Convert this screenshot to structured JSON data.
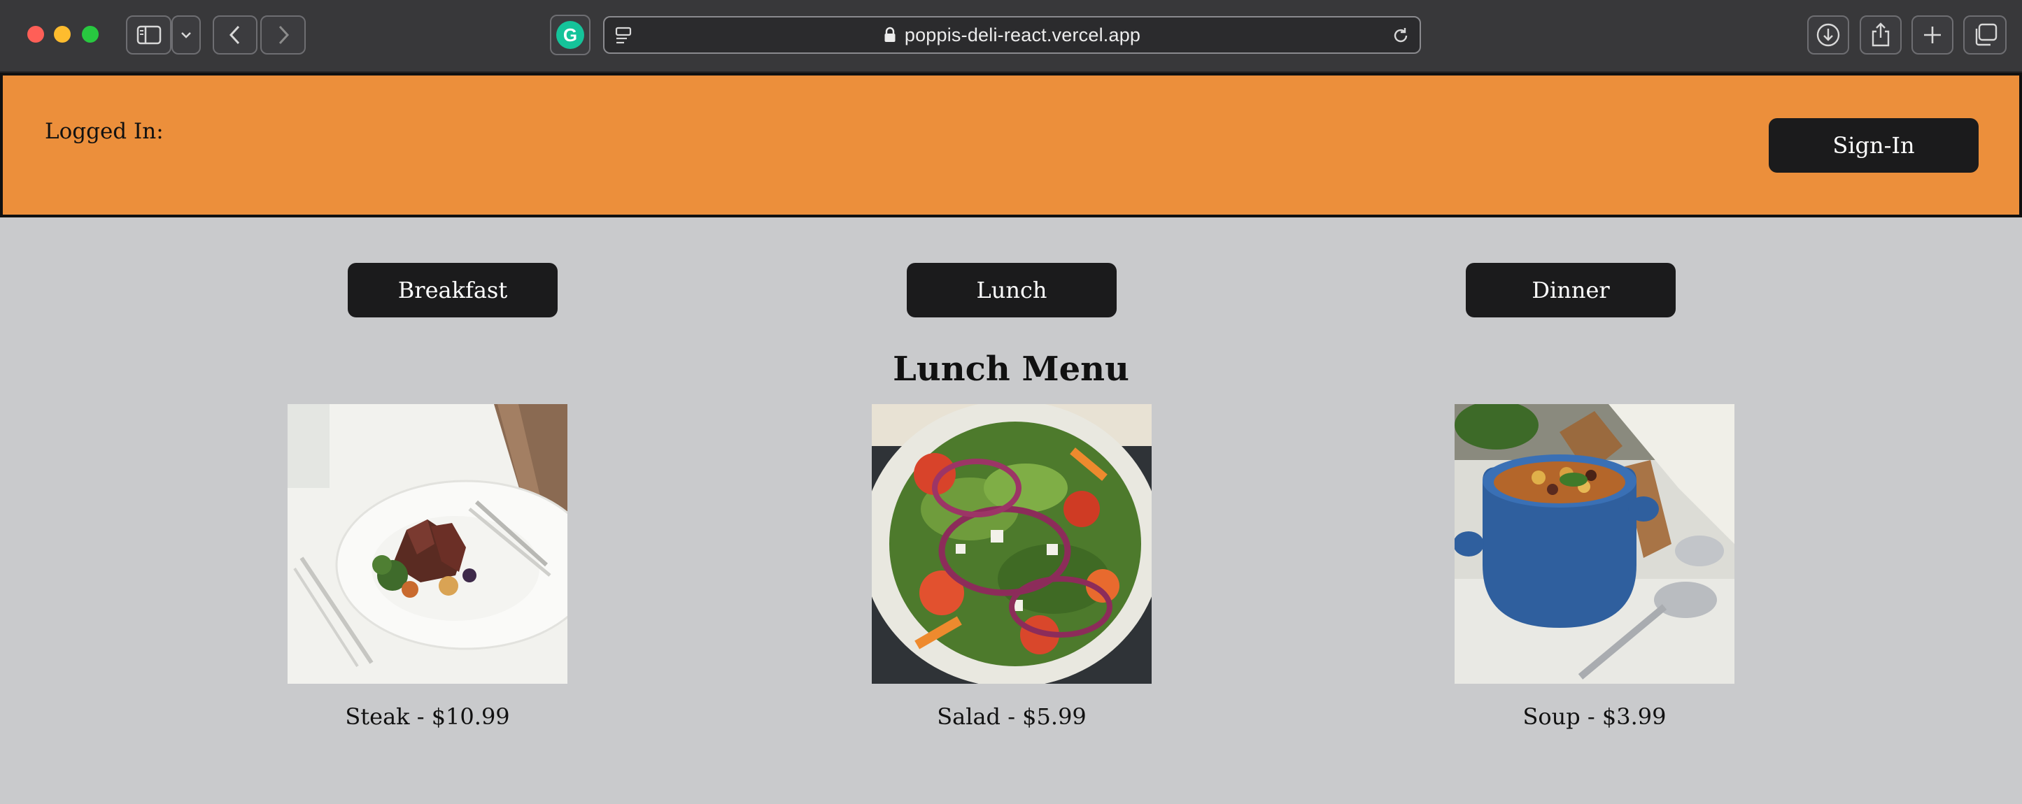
{
  "browser": {
    "url": "poppis-deli-react.vercel.app",
    "icons": [
      "sidebar-icon",
      "chevron-down-icon",
      "back-icon",
      "forward-icon",
      "grammarly-icon",
      "reader-icon",
      "lock-icon",
      "reload-icon",
      "download-icon",
      "share-icon",
      "new-tab-icon",
      "tabs-overview-icon"
    ],
    "grammarly_letter": "G"
  },
  "header": {
    "logged_in_label": "Logged In:",
    "signin_label": "Sign-In",
    "background": "#ec8f3b"
  },
  "meal_tabs": {
    "breakfast": "Breakfast",
    "lunch": "Lunch",
    "dinner": "Dinner"
  },
  "menu": {
    "title": "Lunch Menu",
    "items": [
      {
        "label": "Steak - $10.99",
        "image": "steak-photo"
      },
      {
        "label": "Salad - $5.99",
        "image": "salad-photo"
      },
      {
        "label": "Soup - $3.99",
        "image": "soup-photo"
      }
    ]
  }
}
